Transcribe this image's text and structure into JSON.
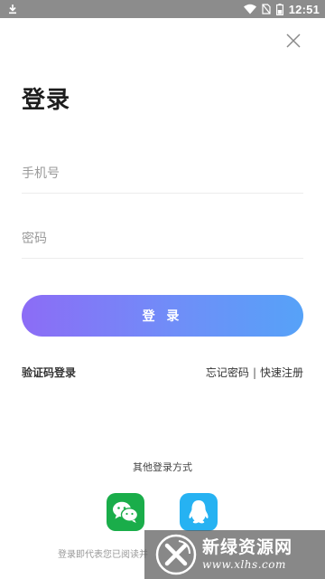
{
  "status_bar": {
    "time": "12:51",
    "icons": [
      "download-icon",
      "wifi-icon",
      "no-sim-icon",
      "battery-icon"
    ]
  },
  "close": {
    "icon": "close-icon"
  },
  "login": {
    "title": "登录",
    "phone_placeholder": "手机号",
    "password_placeholder": "密码",
    "button_label": "登 录",
    "sms_login": "验证码登录",
    "forgot_password": "忘记密码",
    "separator": "|",
    "quick_register": "快速注册"
  },
  "other_login": {
    "title": "其他登录方式",
    "options": [
      "wechat-icon",
      "qq-icon"
    ]
  },
  "agreement": {
    "text": "登录即代表您已阅读并"
  },
  "watermark": {
    "title": "新绿资源网",
    "url": "www.xlhs.com"
  },
  "colors": {
    "status_bar": "#8c8c8c",
    "button_gradient_start": "#8c6cf6",
    "button_gradient_end": "#56a2f8",
    "wechat": "#1aad4a",
    "qq": "#26b2f2"
  }
}
